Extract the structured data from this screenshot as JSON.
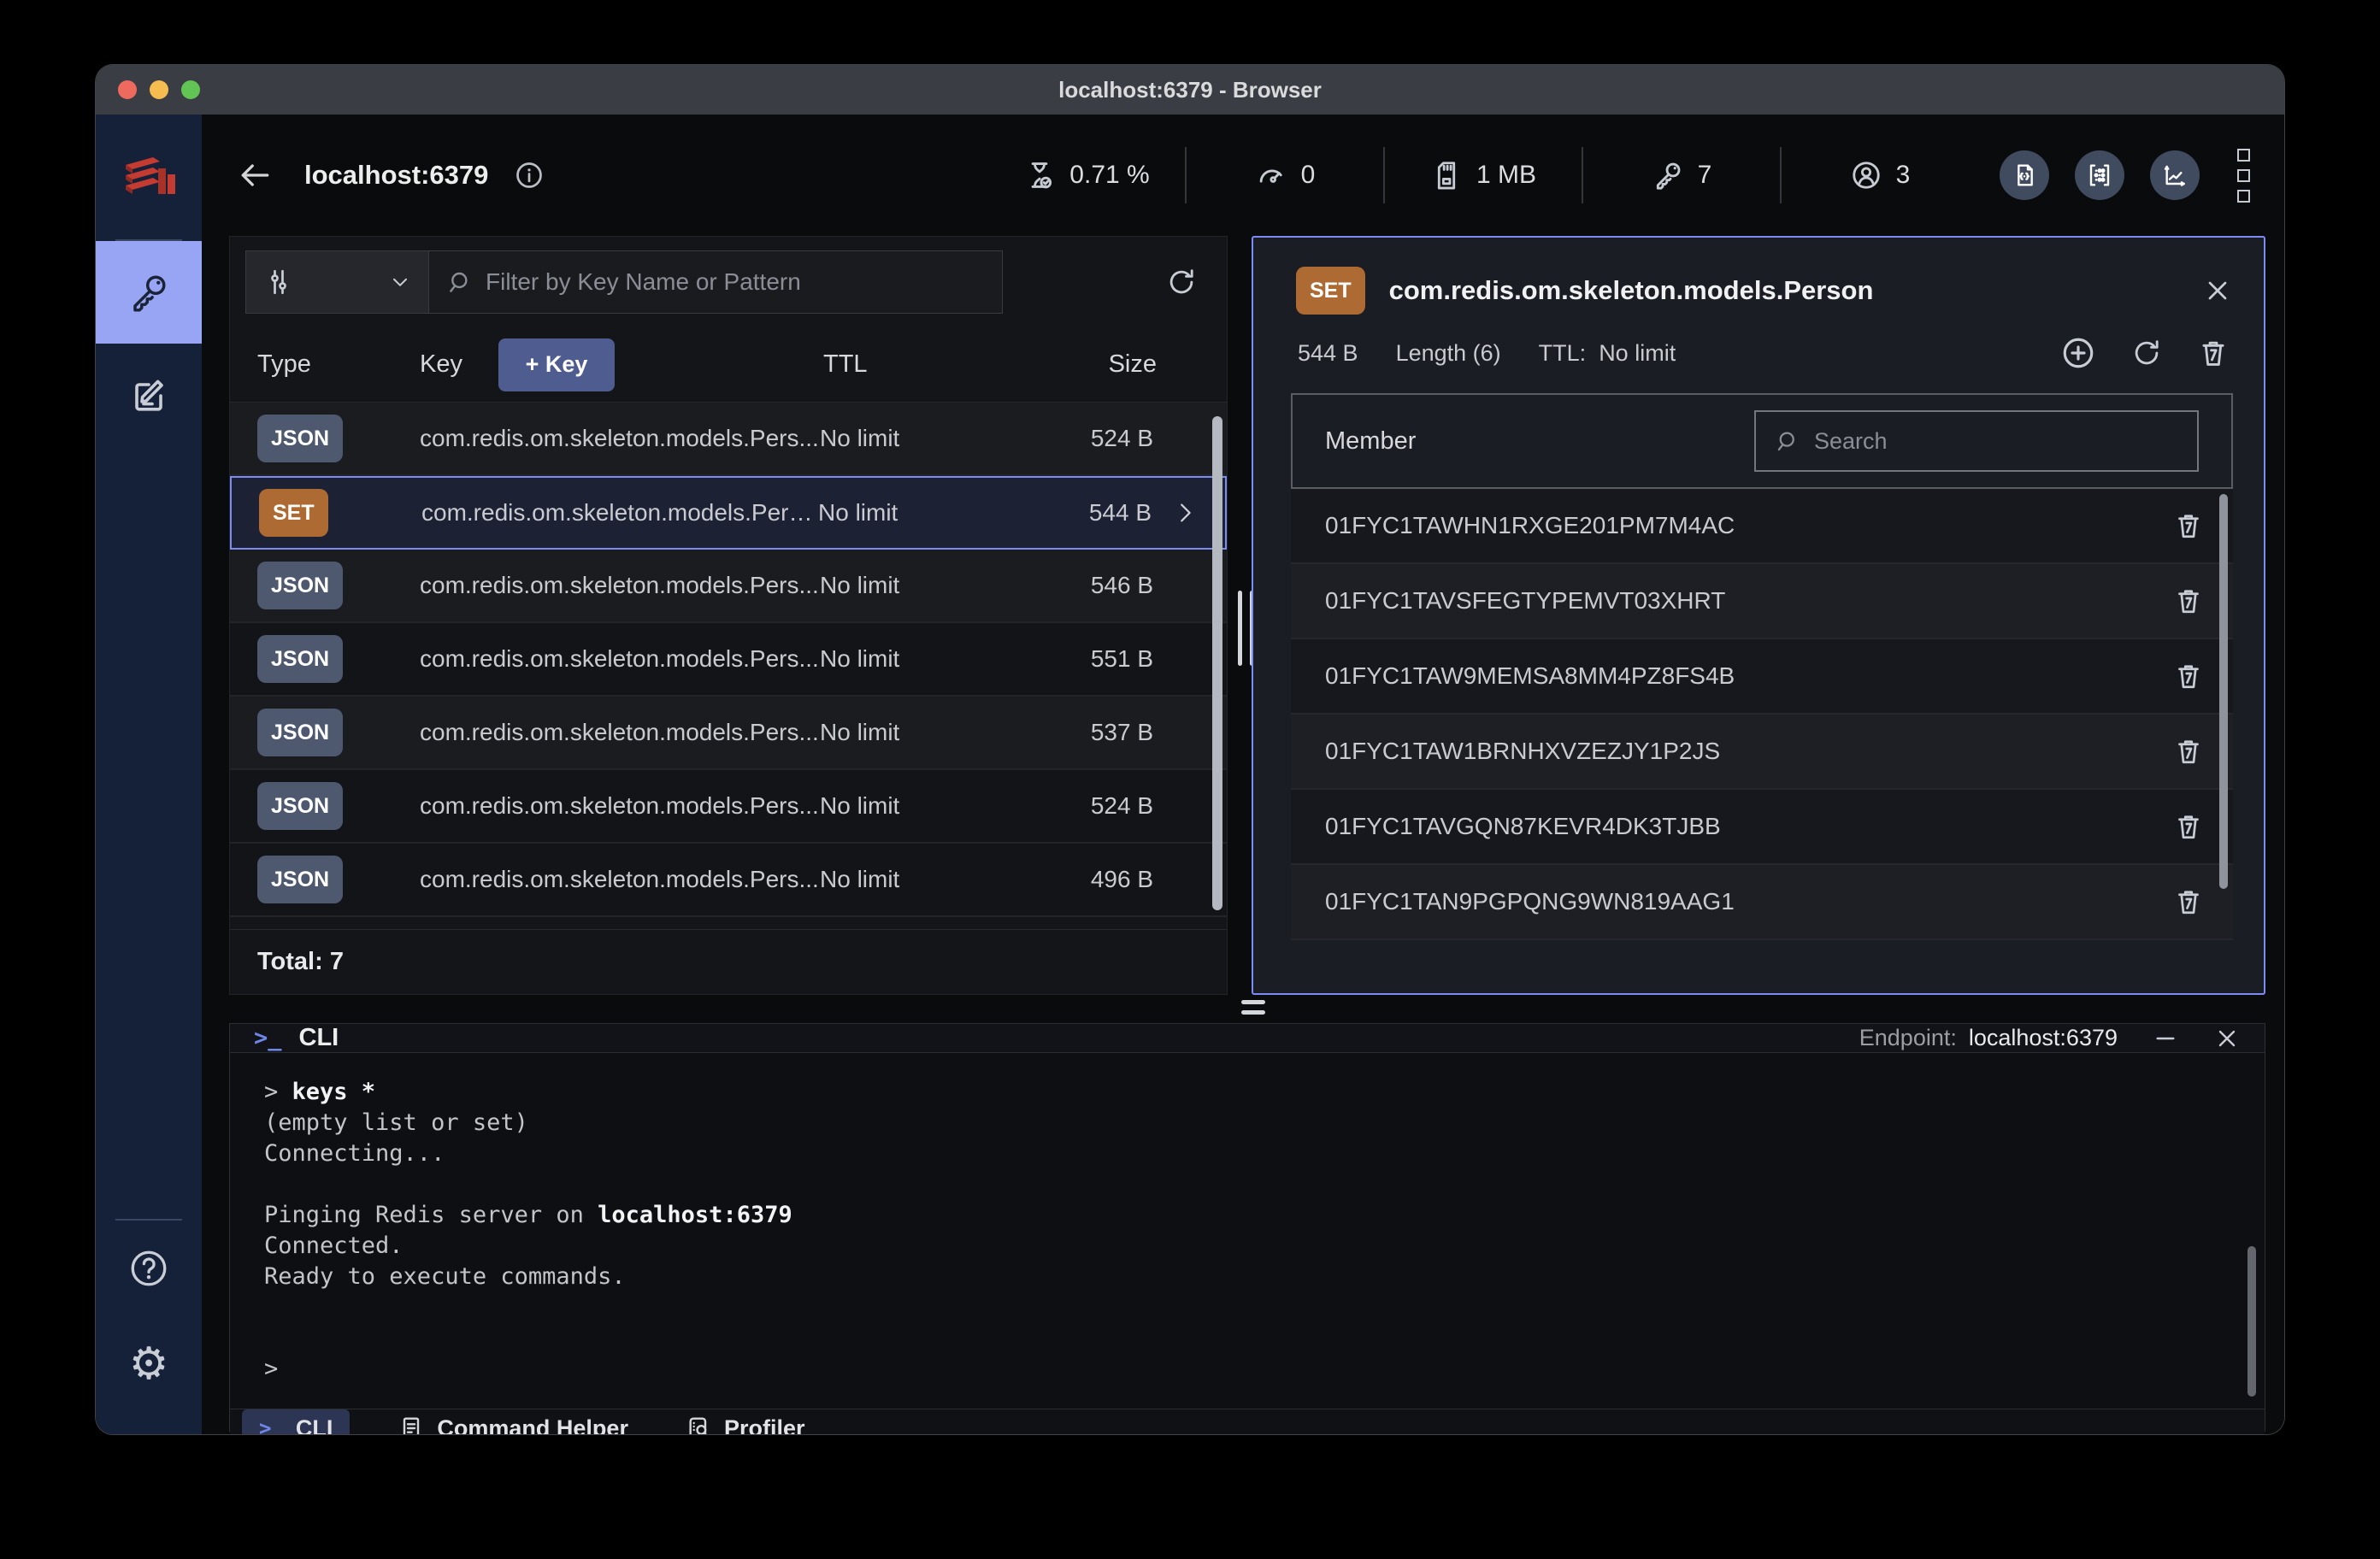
{
  "window": {
    "title": "localhost:6379 - Browser"
  },
  "header": {
    "database": "localhost:6379",
    "stats": [
      {
        "name": "cpu",
        "value": "0.71 %"
      },
      {
        "name": "ops-per-sec",
        "value": "0"
      },
      {
        "name": "memory",
        "value": "1 MB"
      },
      {
        "name": "total-keys",
        "value": "7"
      },
      {
        "name": "connected-clients",
        "value": "3"
      }
    ]
  },
  "keys_panel": {
    "filter": {
      "placeholder": "Filter by Key Name or Pattern"
    },
    "add_key_label": "+ Key",
    "columns": {
      "type": "Type",
      "key": "Key",
      "ttl": "TTL",
      "size": "Size"
    },
    "rows": [
      {
        "type": "JSON",
        "key": "com.redis.om.skeleton.models.Pers...",
        "ttl": "No limit",
        "size": "524 B",
        "selected": false
      },
      {
        "type": "JSON",
        "key": "com.redis.om.skeleton.models.Pers...",
        "ttl": "No limit",
        "size": "537 B",
        "selected": false
      },
      {
        "type": "JSON",
        "key": "com.redis.om.skeleton.models.Pers...",
        "ttl": "No limit",
        "size": "551 B",
        "selected": false
      },
      {
        "type": "JSON",
        "key": "com.redis.om.skeleton.models.Pers...",
        "ttl": "No limit",
        "size": "546 B",
        "selected": false
      },
      {
        "type": "SET",
        "key": "com.redis.om.skeleton.models.Person",
        "ttl": "No limit",
        "size": "544 B",
        "selected": true
      },
      {
        "type": "JSON",
        "key": "com.redis.om.skeleton.models.Pers...",
        "ttl": "No limit",
        "size": "524 B",
        "selected": false
      },
      {
        "type": "JSON",
        "key": "com.redis.om.skeleton.models.Pers...",
        "ttl": "No limit",
        "size": "496 B",
        "selected": false
      }
    ],
    "total": "Total: 7"
  },
  "details_panel": {
    "type_badge": "SET",
    "key_name": "com.redis.om.skeleton.models.Person",
    "size": "544 B",
    "length": "Length (6)",
    "ttl_label": "TTL:",
    "ttl_value": "No limit",
    "member_column": "Member",
    "search_placeholder": "Search",
    "members": [
      "01FYC1TAWHN1RXGE201PM7M4AC",
      "01FYC1TAVSFEGTYPEMVT03XHRT",
      "01FYC1TAW9MEMSA8MM4PZ8FS4B",
      "01FYC1TAW1BRNHXVZEZJY1P2JS",
      "01FYC1TAVGQN87KEVR4DK3TJBB",
      "01FYC1TAN9PGPQNG9WN819AAG1"
    ]
  },
  "cli_panel": {
    "title": "CLI",
    "endpoint_label": "Endpoint:",
    "endpoint_value": "localhost:6379",
    "prompt_glyph": ">_",
    "lines": [
      [
        {
          "text": "> "
        },
        {
          "text": "keys *",
          "bold": true
        }
      ],
      [
        {
          "text": "(empty list or set)"
        }
      ],
      [
        {
          "text": "Connecting..."
        }
      ],
      [],
      [
        {
          "text": "Pinging Redis server on "
        },
        {
          "text": "localhost:6379",
          "bold": true
        }
      ],
      [
        {
          "text": "Connected."
        }
      ],
      [
        {
          "text": "Ready to execute commands."
        }
      ],
      [],
      [],
      [
        {
          "text": ">"
        }
      ]
    ],
    "tabs": [
      {
        "label": "CLI",
        "active": true
      },
      {
        "label": "Command Helper",
        "active": false
      },
      {
        "label": "Profiler",
        "active": false
      }
    ]
  },
  "colors": {
    "accent": "#7c8cf4",
    "sidebar_selected": "#97a5f4",
    "badge_set": "#ad6a33",
    "badge_json": "#4e586f",
    "traffic_red": "#ee6a5f",
    "traffic_yellow": "#f5bd4f",
    "traffic_green": "#61c454"
  }
}
